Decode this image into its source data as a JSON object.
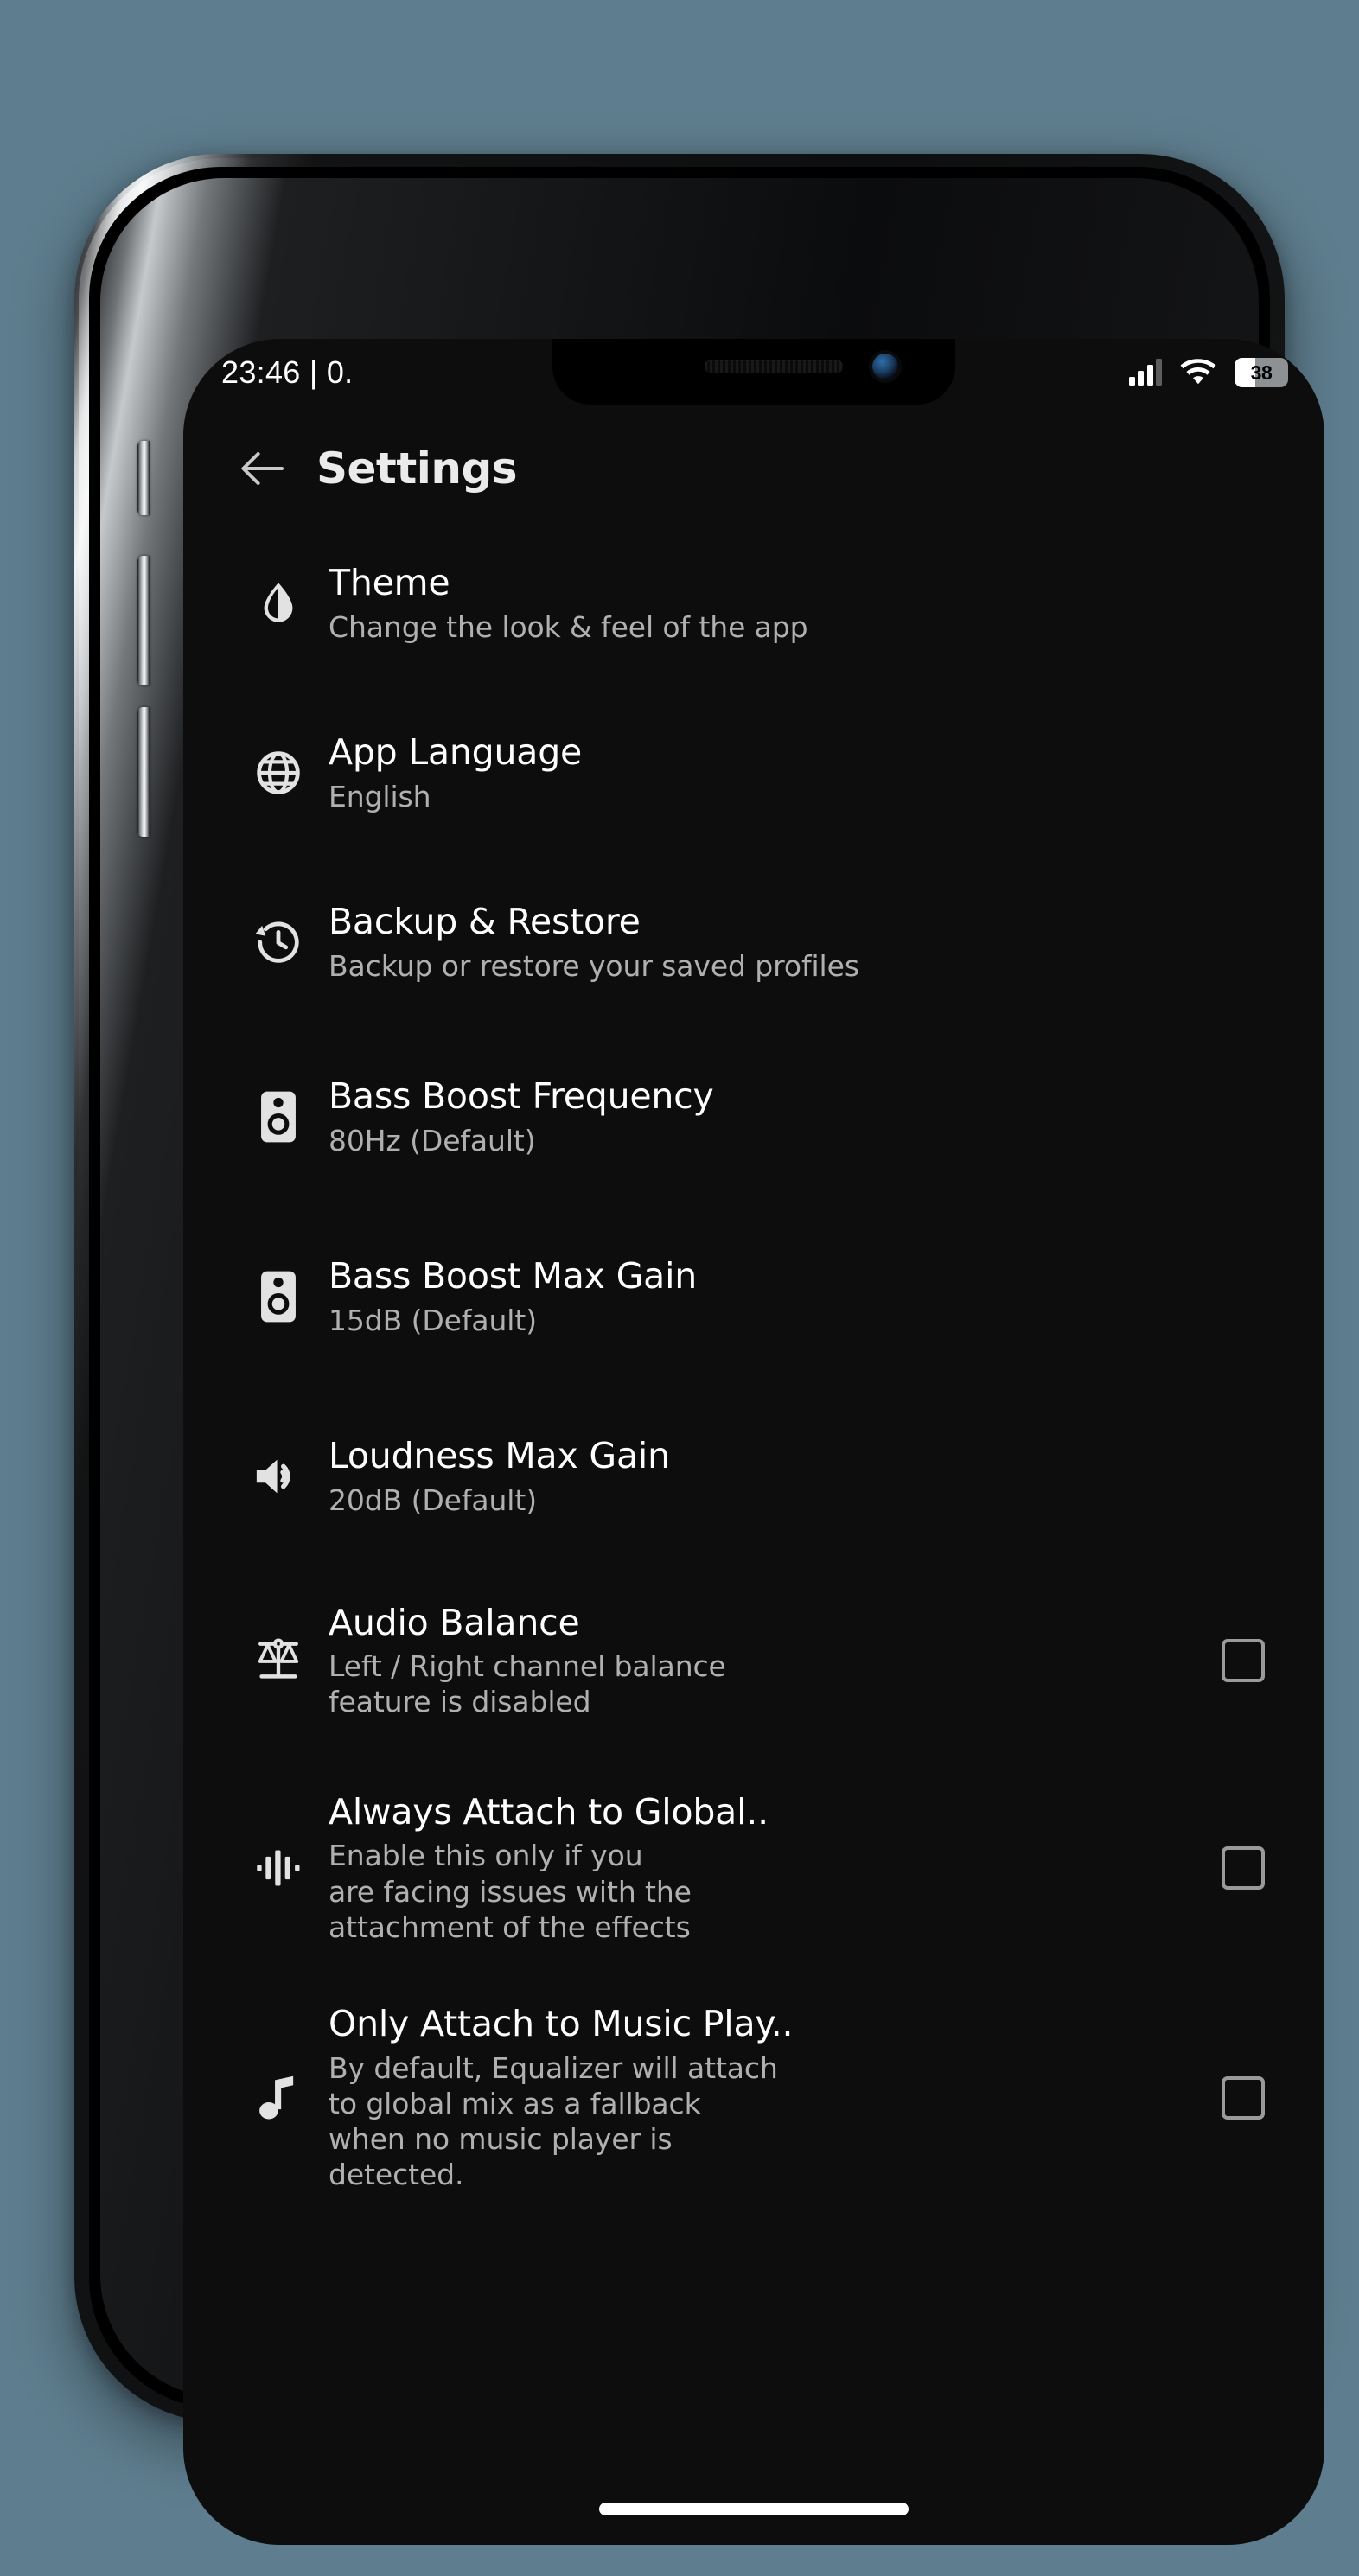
{
  "status_bar": {
    "time_text": "23:46 | 0.",
    "battery_level": "38",
    "signal_icon": "signal-bars-icon",
    "wifi_icon": "wifi-icon",
    "battery_icon": "battery-icon"
  },
  "app_bar": {
    "back_icon": "arrow-left-icon",
    "title": "Settings"
  },
  "settings": {
    "items": [
      {
        "icon": "contrast-drop-icon",
        "title": "Theme",
        "subtitle": "Change the look & feel of the app",
        "has_checkbox": false
      },
      {
        "icon": "globe-icon",
        "title": "App Language",
        "subtitle": "English",
        "has_checkbox": false
      },
      {
        "icon": "history-restore-icon",
        "title": "Backup & Restore",
        "subtitle": "Backup or restore your saved profiles",
        "has_checkbox": false
      },
      {
        "icon": "speaker-icon",
        "title": "Bass Boost Frequency",
        "subtitle": "80Hz (Default)",
        "has_checkbox": false
      },
      {
        "icon": "speaker-icon",
        "title": "Bass Boost Max Gain",
        "subtitle": "15dB (Default)",
        "has_checkbox": false
      },
      {
        "icon": "volume-up-icon",
        "title": "Loudness Max Gain",
        "subtitle": "20dB (Default)",
        "has_checkbox": false
      },
      {
        "icon": "balance-scale-icon",
        "title": "Audio Balance",
        "subtitle": "Left / Right channel balance\nfeature is disabled",
        "has_checkbox": true,
        "checked": false
      },
      {
        "icon": "waveform-icon",
        "title": "Always Attach to Global..",
        "subtitle": "Enable this only if you\nare facing issues with the\nattachment of the effects",
        "has_checkbox": true,
        "checked": false
      },
      {
        "icon": "music-note-icon",
        "title": "Only Attach to Music Play..",
        "subtitle": "By default, Equalizer will attach\nto global mix as a fallback\nwhen no music player is\ndetected.",
        "has_checkbox": true,
        "checked": false
      }
    ]
  },
  "system": {
    "home_indicator": "home-indicator",
    "notch": "notch",
    "earpiece": "earpiece-speaker",
    "front_camera": "front-camera"
  },
  "colors": {
    "screen_background": "#0d0d0d",
    "title_text": "#fefefe",
    "subtitle_text": "#b0b0b0",
    "icon": "#dcdcdc",
    "checkbox_border": "#9a9a9a",
    "wallpaper": "#5e7d8e"
  }
}
